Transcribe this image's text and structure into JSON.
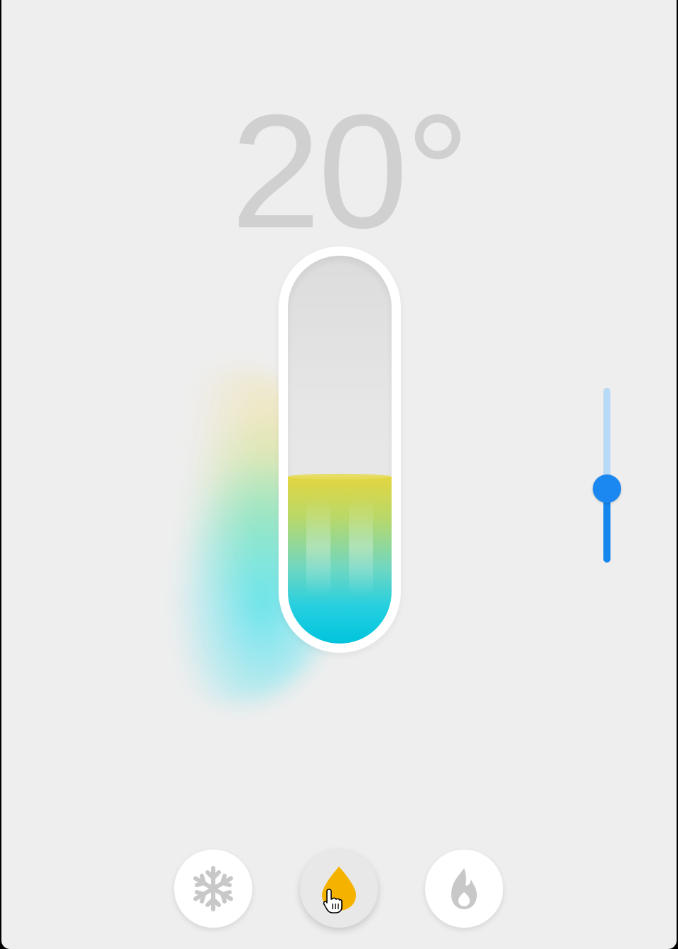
{
  "thermostat": {
    "temperature_display": "20°",
    "fill_level": 0.43,
    "colors": {
      "readout_text": "#d0d0d0",
      "fill_top": "#e3d640",
      "fill_bottom": "#00c4dc",
      "slider_accent": "#1a88f0",
      "slider_track": "#b7daf6",
      "active_mode_icon": "#f5b300",
      "inactive_mode_icon": "#c8c8c8"
    }
  },
  "slider": {
    "orientation": "vertical",
    "value": 0.42
  },
  "modes": {
    "selected": "auto",
    "items": [
      {
        "id": "cool",
        "icon": "snowflake-icon",
        "active": false
      },
      {
        "id": "auto",
        "icon": "water-drop-icon",
        "active": true
      },
      {
        "id": "heat",
        "icon": "flame-icon",
        "active": false
      }
    ]
  }
}
